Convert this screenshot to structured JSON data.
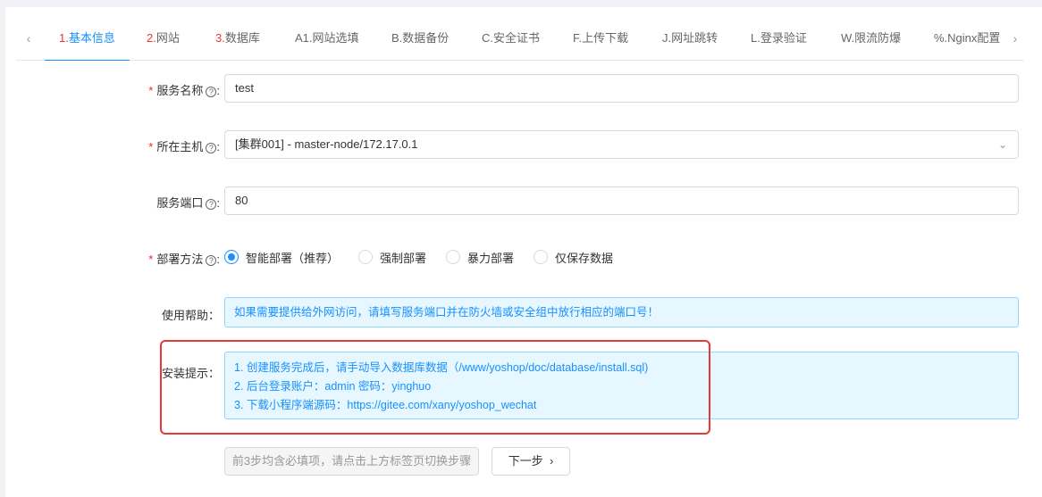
{
  "tabs": {
    "prev_icon": "‹",
    "next_icon": "›",
    "items": [
      {
        "num": "1.",
        "label": "基本信息",
        "active": true
      },
      {
        "num": "2.",
        "label": "网站"
      },
      {
        "num": "3.",
        "label": "数据库"
      },
      {
        "num": "",
        "label": "A1.网站选填"
      },
      {
        "num": "",
        "label": "B.数据备份"
      },
      {
        "num": "",
        "label": "C.安全证书"
      },
      {
        "num": "",
        "label": "F.上传下载"
      },
      {
        "num": "",
        "label": "J.网址跳转"
      },
      {
        "num": "",
        "label": "L.登录验证"
      },
      {
        "num": "",
        "label": "W.限流防爆"
      },
      {
        "num": "",
        "label": "%.Nginx配置"
      }
    ]
  },
  "form": {
    "service_name": {
      "label": "服务名称",
      "value": "test",
      "required": "*"
    },
    "host": {
      "label": "所在主机",
      "value": "[集群001] - master-node/172.17.0.1",
      "required": "*",
      "arrow": "⌄"
    },
    "port": {
      "label": "服务端口",
      "value": "80"
    },
    "deploy": {
      "label": "部署方法",
      "required": "*",
      "options": [
        "智能部署（推荐）",
        "强制部署",
        "暴力部署",
        "仅保存数据"
      ],
      "selected": "智能部署（推荐）"
    },
    "help": {
      "label": "使用帮助：",
      "text": "如果需要提供给外网访问，请填写服务端口并在防火墙或安全组中放行相应的端口号！"
    },
    "install_tips": {
      "label": "安装提示：",
      "lines": [
        "1. 创建服务完成后，请手动导入数据库数据（/www/yoshop/doc/database/install.sql)",
        "2. 后台登录账户：admin 密码：yinghuo",
        "3. 下载小程序端源码：https://gitee.com/xany/yoshop_wechat"
      ]
    }
  },
  "buttons": {
    "disabled_label": "前3步均含必填项，请点击上方标签页切换步骤",
    "next_label": "下一步",
    "next_icon": "›"
  },
  "help_icon": "?",
  "colors": {
    "accent": "#1890ff",
    "required": "#f5222d",
    "highlight": "#e53935",
    "info_bg": "#e6f7ff"
  }
}
